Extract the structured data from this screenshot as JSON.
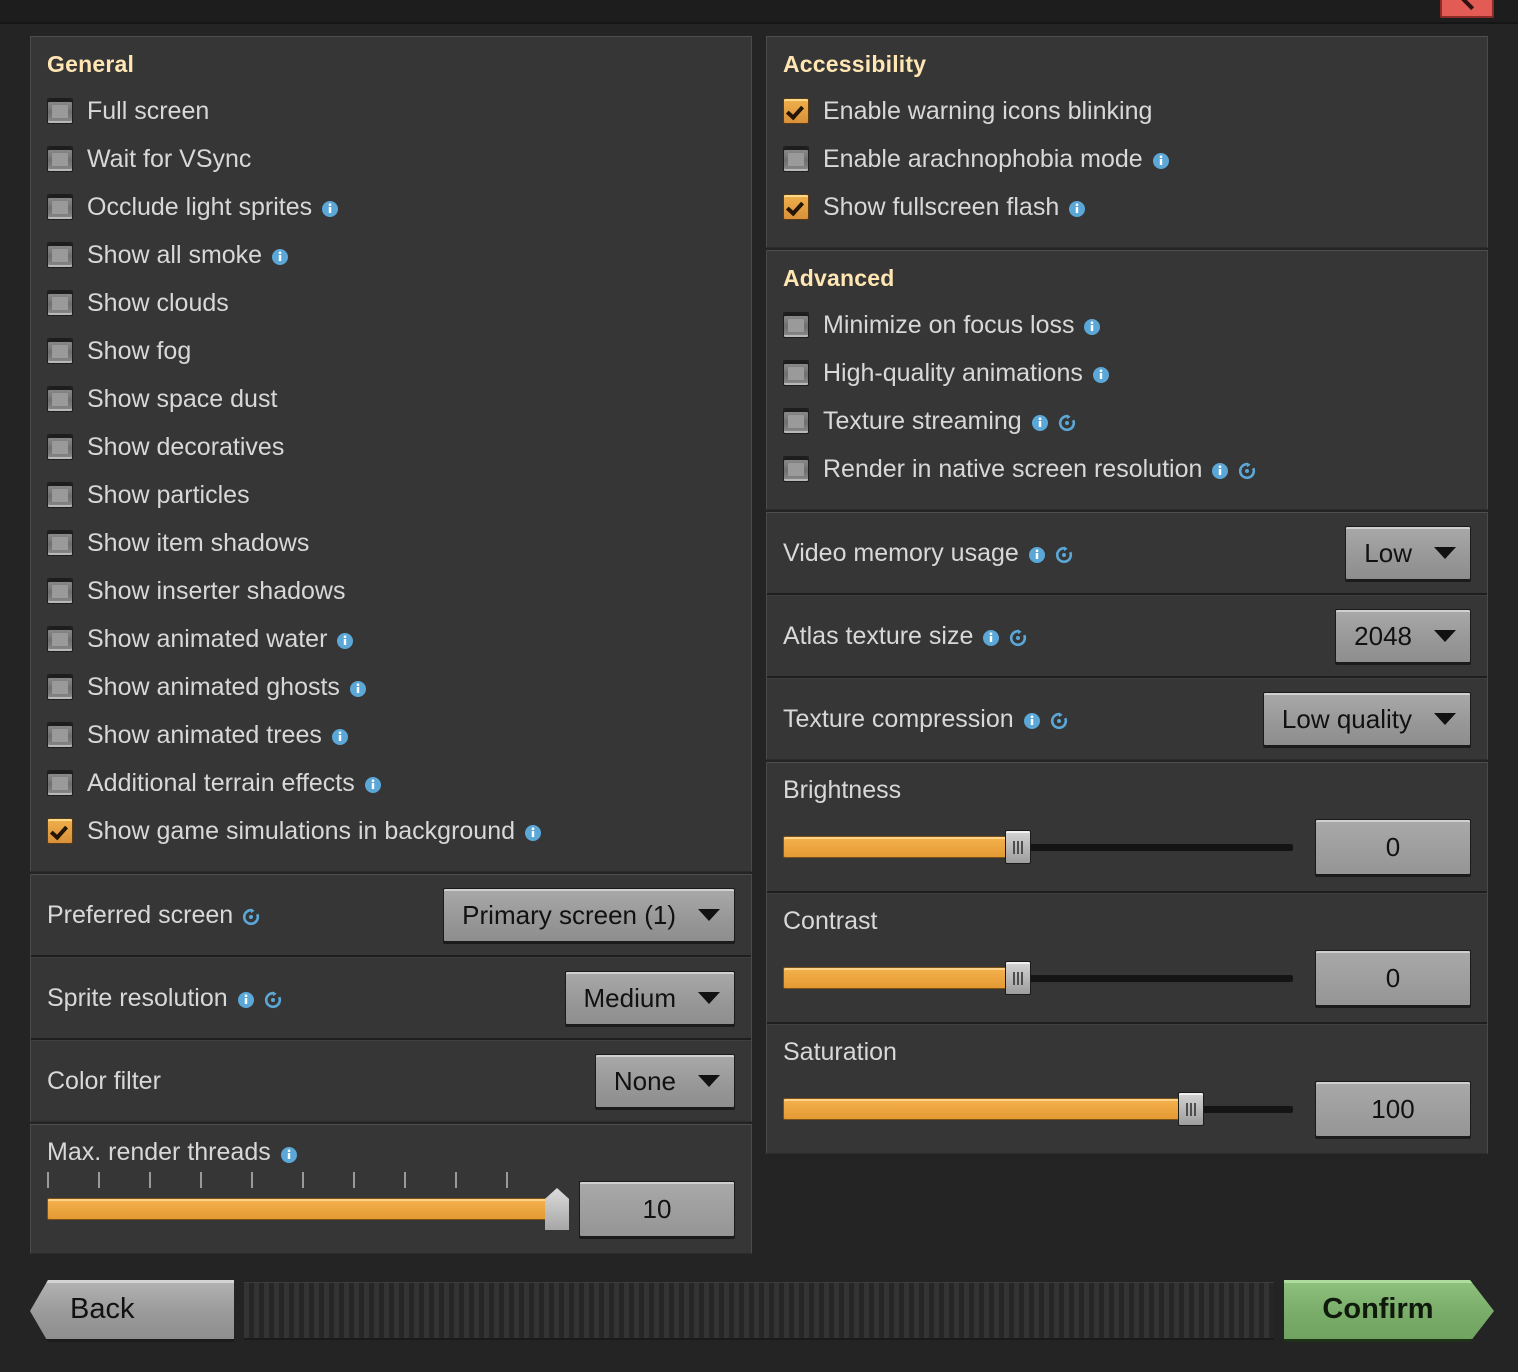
{
  "window": {
    "close_icon": "close-icon"
  },
  "general": {
    "title": "General",
    "items": [
      {
        "label": "Full screen",
        "checked": false,
        "info": false,
        "reset": false
      },
      {
        "label": "Wait for VSync",
        "checked": false,
        "info": false,
        "reset": false
      },
      {
        "label": "Occlude light sprites",
        "checked": false,
        "info": true,
        "reset": false
      },
      {
        "label": "Show all smoke",
        "checked": false,
        "info": true,
        "reset": false
      },
      {
        "label": "Show clouds",
        "checked": false,
        "info": false,
        "reset": false
      },
      {
        "label": "Show fog",
        "checked": false,
        "info": false,
        "reset": false
      },
      {
        "label": "Show space dust",
        "checked": false,
        "info": false,
        "reset": false
      },
      {
        "label": "Show decoratives",
        "checked": false,
        "info": false,
        "reset": false
      },
      {
        "label": "Show particles",
        "checked": false,
        "info": false,
        "reset": false
      },
      {
        "label": "Show item shadows",
        "checked": false,
        "info": false,
        "reset": false
      },
      {
        "label": "Show inserter shadows",
        "checked": false,
        "info": false,
        "reset": false
      },
      {
        "label": "Show animated water",
        "checked": false,
        "info": true,
        "reset": false
      },
      {
        "label": "Show animated ghosts",
        "checked": false,
        "info": true,
        "reset": false
      },
      {
        "label": "Show animated trees",
        "checked": false,
        "info": true,
        "reset": false
      },
      {
        "label": "Additional terrain effects",
        "checked": false,
        "info": true,
        "reset": false
      },
      {
        "label": "Show game simulations in background",
        "checked": true,
        "info": true,
        "reset": false
      }
    ]
  },
  "left_options": [
    {
      "label": "Preferred screen",
      "info": false,
      "reset": true,
      "value": "Primary screen (1)"
    },
    {
      "label": "Sprite resolution",
      "info": true,
      "reset": true,
      "value": "Medium"
    },
    {
      "label": "Color filter",
      "info": false,
      "reset": false,
      "value": "None"
    }
  ],
  "render_threads": {
    "label": "Max. render threads",
    "info": true,
    "reset": false,
    "value": "10",
    "percent": 100,
    "ticks": 10
  },
  "accessibility": {
    "title": "Accessibility",
    "items": [
      {
        "label": "Enable warning icons blinking",
        "checked": true,
        "info": false,
        "reset": false
      },
      {
        "label": "Enable arachnophobia mode",
        "checked": false,
        "info": true,
        "reset": false
      },
      {
        "label": "Show fullscreen flash",
        "checked": true,
        "info": true,
        "reset": false
      }
    ]
  },
  "advanced": {
    "title": "Advanced",
    "items": [
      {
        "label": "Minimize on focus loss",
        "checked": false,
        "info": true,
        "reset": false
      },
      {
        "label": "High-quality animations",
        "checked": false,
        "info": true,
        "reset": false
      },
      {
        "label": "Texture streaming",
        "checked": false,
        "info": true,
        "reset": true
      },
      {
        "label": "Render in native screen resolution",
        "checked": false,
        "info": true,
        "reset": true
      }
    ]
  },
  "right_options": [
    {
      "label": "Video memory usage",
      "info": true,
      "reset": true,
      "value": "Low"
    },
    {
      "label": "Atlas texture size",
      "info": true,
      "reset": true,
      "value": "2048"
    },
    {
      "label": "Texture compression",
      "info": true,
      "reset": true,
      "value": "Low quality"
    }
  ],
  "sliders": [
    {
      "label": "Brightness",
      "value": "0",
      "percent": 46
    },
    {
      "label": "Contrast",
      "value": "0",
      "percent": 46
    },
    {
      "label": "Saturation",
      "value": "100",
      "percent": 80
    }
  ],
  "footer": {
    "back_label": "Back",
    "confirm_label": "Confirm"
  },
  "colors": {
    "accent_orange": "#e49a33",
    "panel_bg": "#363636",
    "window_bg": "#242424",
    "title_text": "#ffe6b3",
    "body_text": "#d8d8d8",
    "info_blue": "#5ba8d8",
    "confirm_green": "#79ad69",
    "close_red": "#e35b55"
  }
}
